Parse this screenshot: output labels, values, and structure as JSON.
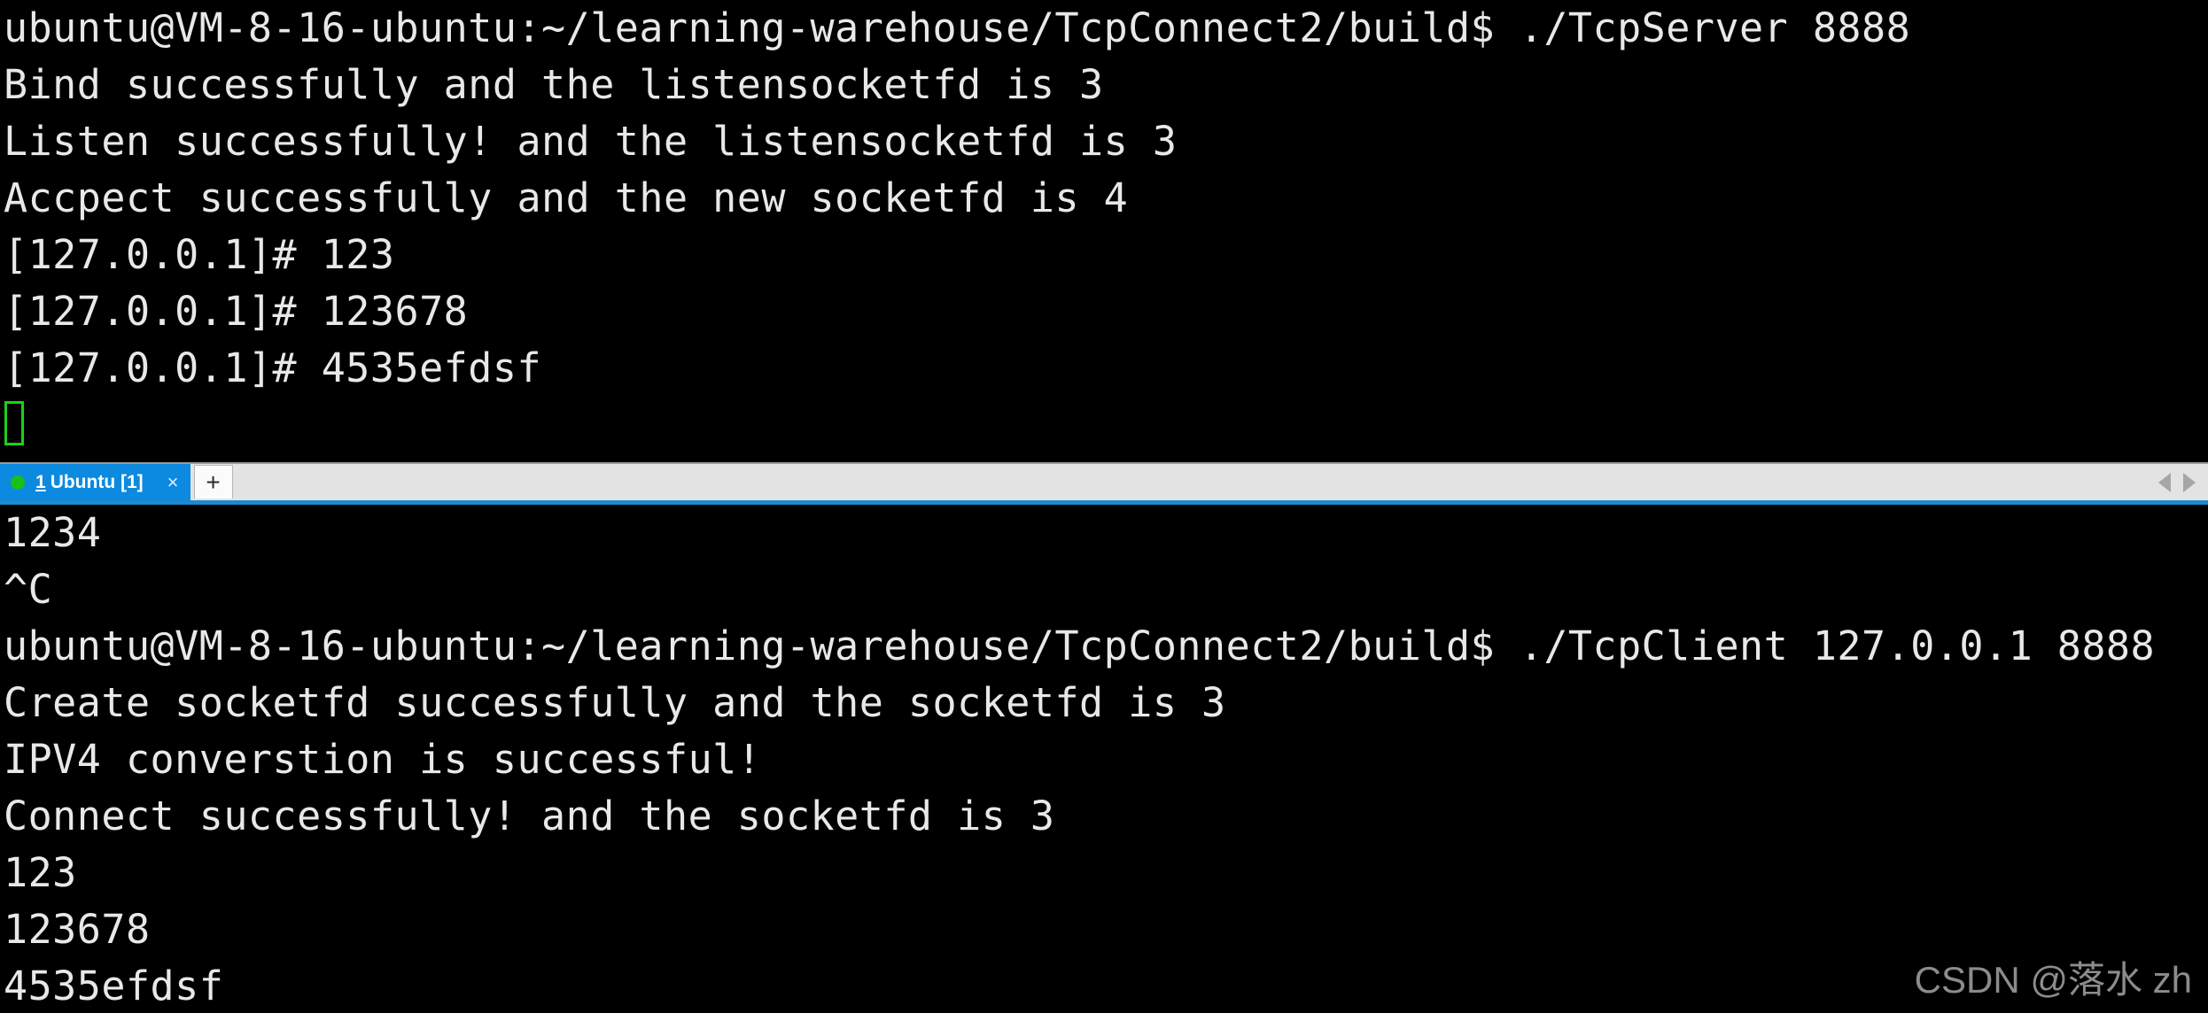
{
  "terminal": {
    "top_pane": {
      "lines": [
        "ubuntu@VM-8-16-ubuntu:~/learning-warehouse/TcpConnect2/build$ ./TcpServer 8888",
        "Bind successfully and the listensocketfd is 3",
        "Listen successfully! and the listensocketfd is 3",
        "Accpect successfully and the new socketfd is 4",
        "[127.0.0.1]# 123",
        "[127.0.0.1]# 123678",
        "[127.0.0.1]# 4535efdsf"
      ],
      "cursor": {
        "visible": true,
        "color": "#19d219"
      }
    },
    "bottom_pane": {
      "lines": [
        "1234",
        "^C",
        "ubuntu@VM-8-16-ubuntu:~/learning-warehouse/TcpConnect2/build$ ./TcpClient 127.0.0.1 8888",
        "Create socketfd successfully and the socketfd is 3",
        "IPV4 converstion is successful!",
        "Connect successfully! and the socketfd is 3",
        "123",
        "123678",
        "4535efdsf"
      ]
    },
    "colors": {
      "background": "#000000",
      "foreground": "#e8e8e8"
    }
  },
  "tabbar": {
    "background": "#e3e3e3",
    "accent": "#1c8ad0",
    "tabs": [
      {
        "index": "1",
        "title": "Ubuntu [1]",
        "status_dot": "green",
        "close_label": "×",
        "active": true
      }
    ],
    "new_tab_label": "+",
    "scroll_left_icon": "chevron-left-icon",
    "scroll_right_icon": "chevron-right-icon"
  },
  "watermark": {
    "text": "CSDN @落水 zh"
  }
}
